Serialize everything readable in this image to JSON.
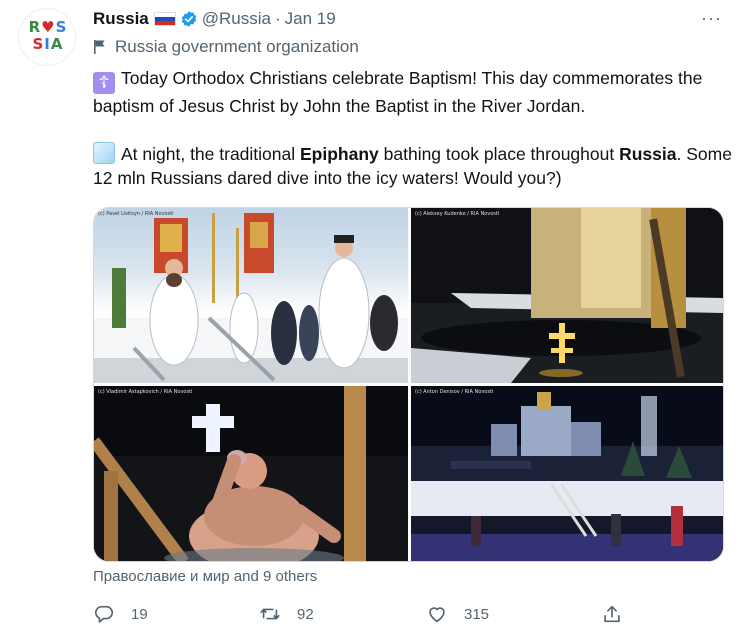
{
  "avatar": {
    "line1": "R♥S",
    "line2": "SIA",
    "colors": [
      "#3a8a45",
      "#d62828",
      "#3a7bd5"
    ]
  },
  "header": {
    "name": "Russia",
    "handle": "@Russia",
    "separator": "·",
    "date": "Jan 19",
    "menu": "···",
    "flag_colors": [
      "#ffffff",
      "#1f4fb4",
      "#d52b1e"
    ],
    "verified_color": "#1d9bf0"
  },
  "org_label": "Russia government organization",
  "body": {
    "p1_emoji": "☦",
    "p1_text": "Today Orthodox Christians celebrate Baptism! This day commemorates the baptism of Jesus Christ by John the Baptist in the River Jordan.",
    "p2_a": "At night, the traditional ",
    "p2_bold1": "Epiphany",
    "p2_b": " bathing took place throughout ",
    "p2_bold2": "Russia",
    "p2_c": ". Some 12 mln Russians dared dive into the icy waters! Would you?)"
  },
  "photos": [
    {
      "credit": "(c) Pavel Lisitsyn / RIA Novosti"
    },
    {
      "credit": "(c) Aleksey Kudenko / RIA Novosti"
    },
    {
      "credit": "(c) Vladimir Astapkovich / RIA Novosti"
    },
    {
      "credit": "(c) Anton Denisov / RIA Novosti"
    }
  ],
  "reactions": "Православие и мир and 9 others",
  "actions": {
    "reply_count": "19",
    "retweet_count": "92",
    "like_count": "315"
  }
}
